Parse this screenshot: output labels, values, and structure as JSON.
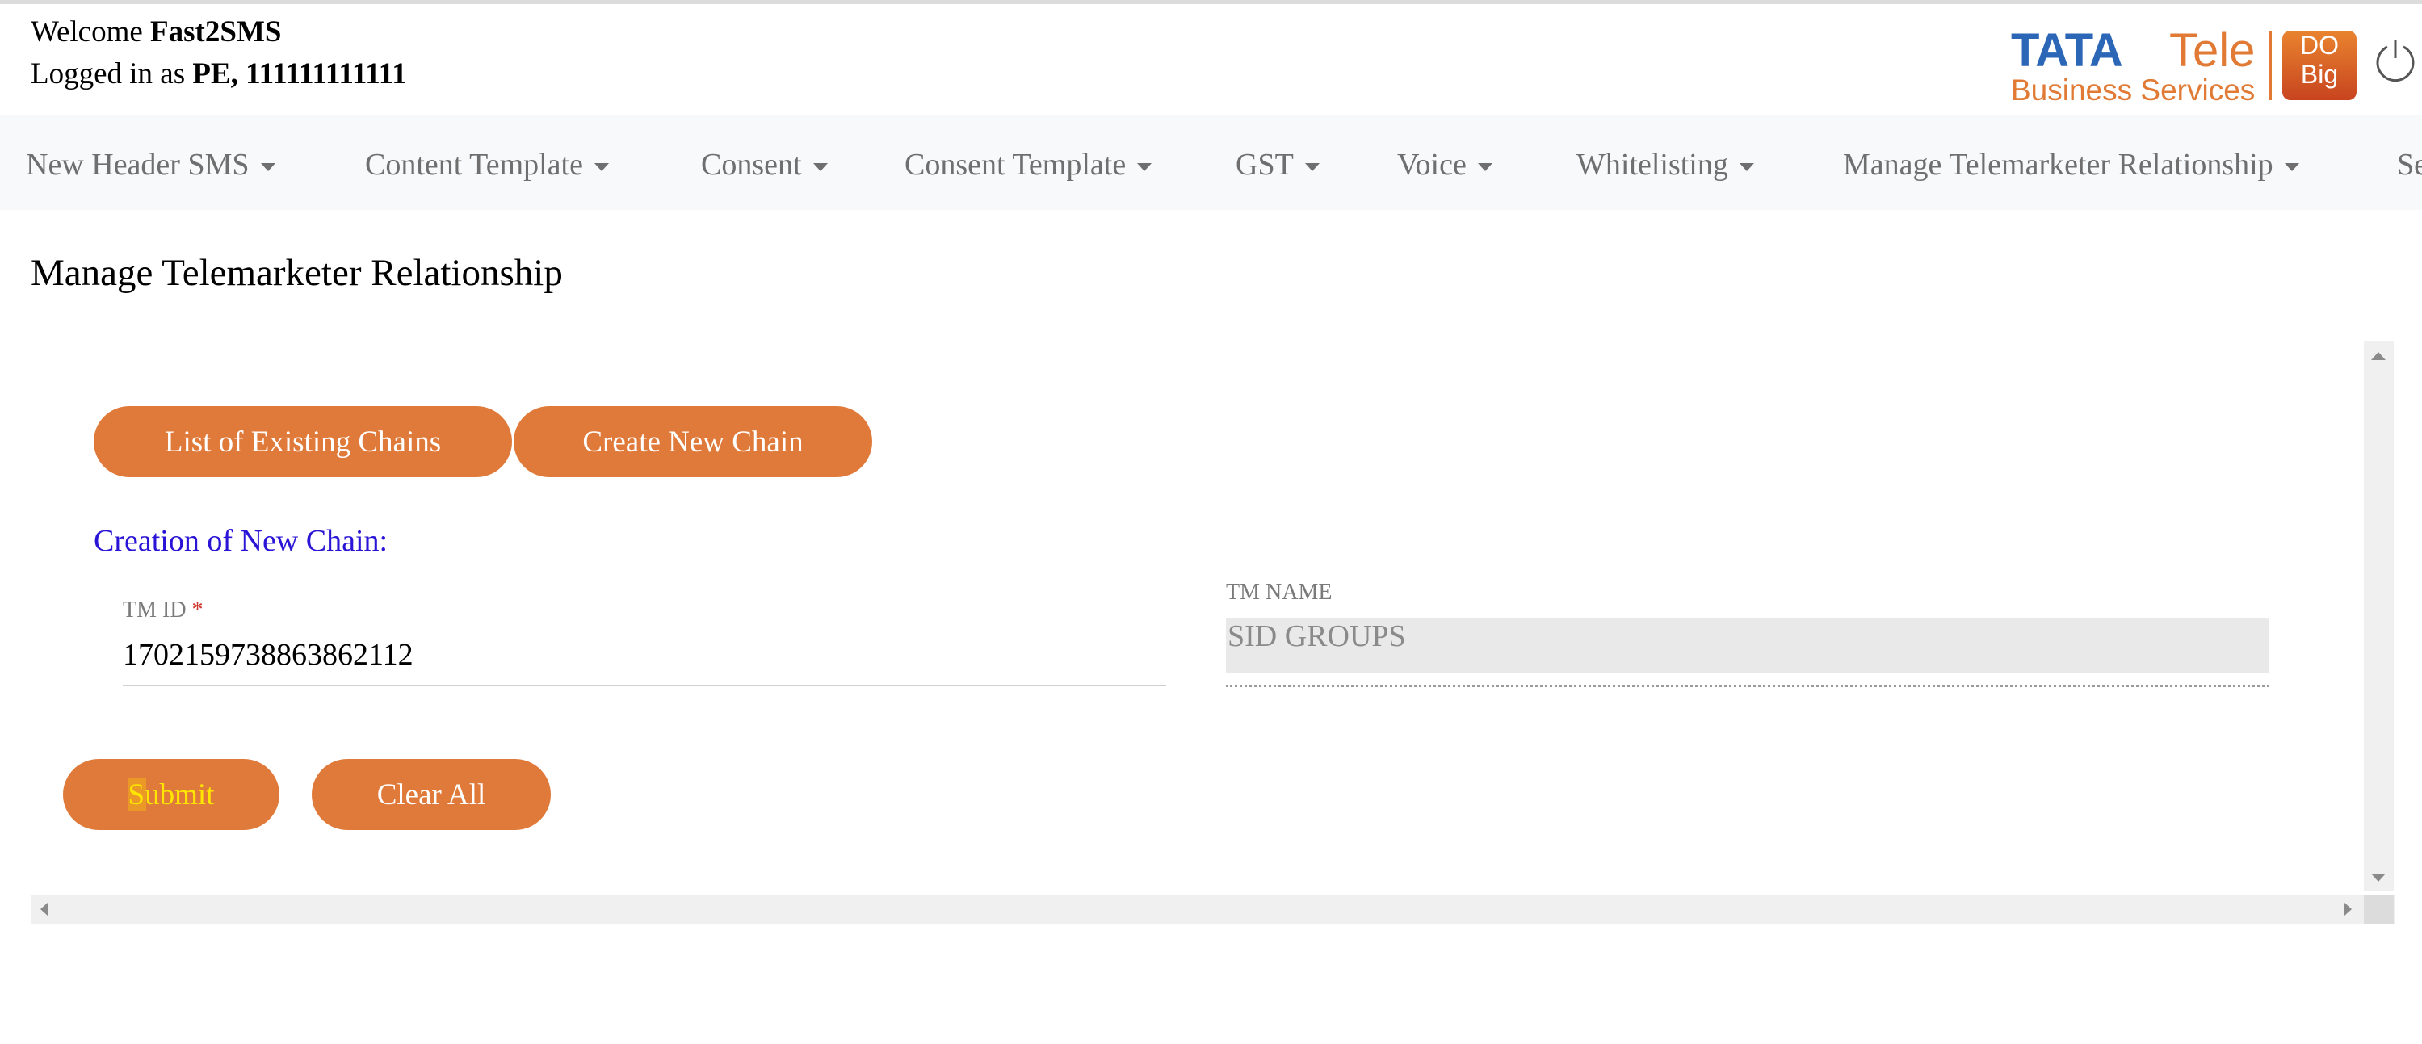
{
  "header": {
    "welcome_prefix": "Welcome",
    "welcome_name": "Fast2SMS",
    "logged_prefix": "Logged in as",
    "logged_value": "PE, 111111111111",
    "logo": {
      "brand": "TATA",
      "sub": "Tele",
      "line2": "Business Services",
      "badge_top": "DO",
      "badge_bottom": "Big"
    },
    "power_icon": "power-icon"
  },
  "nav": {
    "items": [
      {
        "label": "New Header SMS"
      },
      {
        "label": "Content Template"
      },
      {
        "label": "Consent"
      },
      {
        "label": "Consent Template"
      },
      {
        "label": "GST"
      },
      {
        "label": "Voice"
      },
      {
        "label": "Whitelisting"
      },
      {
        "label": "Manage Telemarketer Relationship"
      },
      {
        "label": "Se"
      }
    ]
  },
  "page": {
    "title": "Manage Telemarketer Relationship",
    "buttons": {
      "list": "List of Existing Chains",
      "create": "Create New Chain"
    },
    "section_title": "Creation of New Chain:",
    "form": {
      "tm_id_label": "TM ID",
      "required_mark": "*",
      "tm_id_value": "1702159738863862112",
      "tm_name_label": "TM NAME",
      "tm_name_value": "SID GROUPS"
    },
    "actions": {
      "submit": "Submit",
      "clear": "Clear All"
    }
  },
  "colors": {
    "accent": "#e07a3a",
    "section_title": "#2a15d6",
    "required": "#d0342c",
    "nav_bg": "#f8f9fa"
  }
}
